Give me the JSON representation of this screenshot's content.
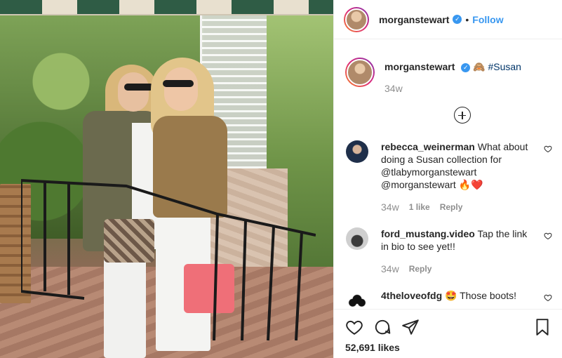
{
  "post": {
    "username": "morganstewart",
    "separator": "•",
    "follow_label": "Follow",
    "verified_icon": "verified-badge-icon"
  },
  "caption": {
    "username": "morganstewart",
    "emoji": "🙈",
    "hashtag": "#Susan",
    "time": "34w"
  },
  "comments": [
    {
      "username": "rebecca_weinerman",
      "text": "What about doing a Susan collection for @tlabymorganstewart @morganstewart 🔥❤️",
      "time": "34w",
      "likes": "1 like",
      "reply": "Reply"
    },
    {
      "username": "ford_mustang.video",
      "text": "Tap the link in bio to see yet!!",
      "time": "34w",
      "reply": "Reply"
    },
    {
      "username": "4theloveofdg",
      "text": "🤩 Those boots!"
    }
  ],
  "footer": {
    "likes": "52,691 likes"
  },
  "colors": {
    "link": "#3897f0",
    "muted": "#8e8e8e",
    "text": "#262626"
  }
}
